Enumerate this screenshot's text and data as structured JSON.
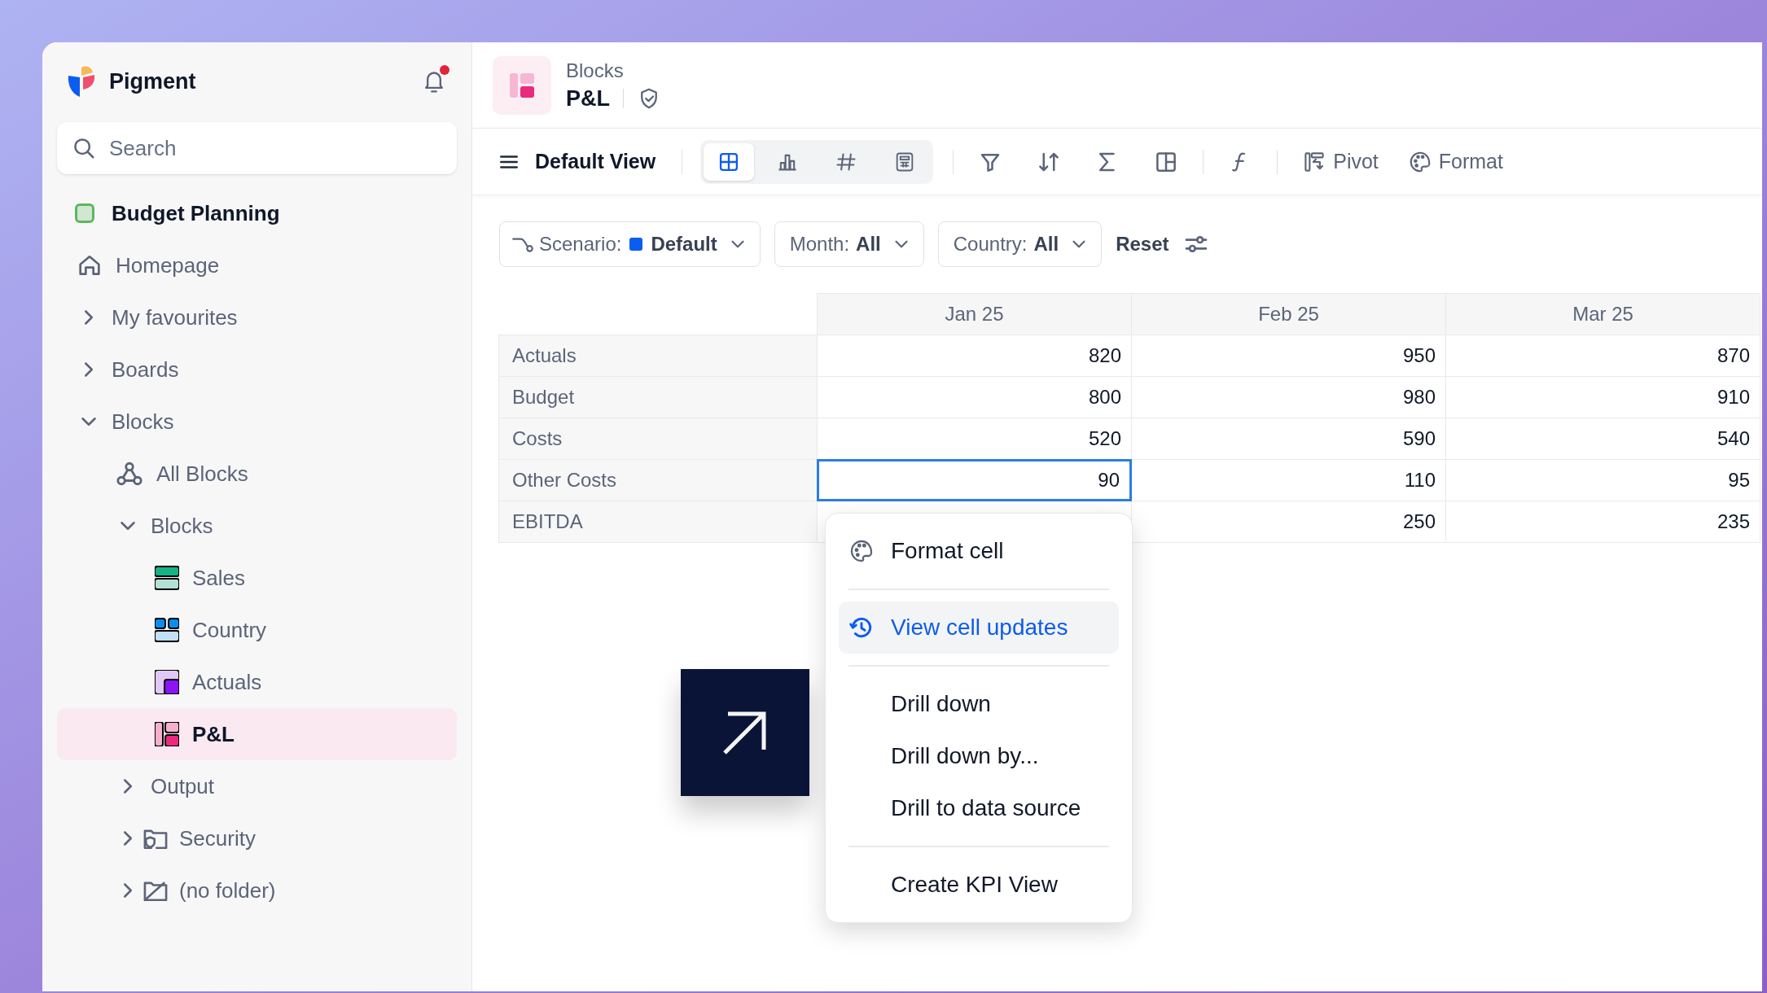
{
  "app": {
    "name": "Pigment",
    "notifications_unread": true
  },
  "sidebar": {
    "search": {
      "placeholder": "Search"
    },
    "workspace": {
      "label": "Budget Planning",
      "color": "#5cb85c"
    },
    "items": [
      {
        "label": "Homepage",
        "kind": "home",
        "selected": false
      },
      {
        "label": "My favourites",
        "kind": "folder",
        "expanded": false,
        "selected": false
      },
      {
        "label": "Boards",
        "kind": "folder",
        "expanded": false,
        "selected": false
      },
      {
        "label": "Blocks",
        "kind": "folder",
        "expanded": true,
        "selected": false,
        "children": [
          {
            "label": "All Blocks",
            "kind": "all-blocks",
            "selected": false
          },
          {
            "label": "Blocks",
            "kind": "folder",
            "expanded": true,
            "selected": false,
            "children": [
              {
                "label": "Sales",
                "kind": "list",
                "color": "#16b286",
                "selected": false
              },
              {
                "label": "Country",
                "kind": "dimension",
                "color": "#0a8cf0",
                "selected": false
              },
              {
                "label": "Actuals",
                "kind": "metric",
                "color": "#8a14f5",
                "selected": false
              },
              {
                "label": "P&L",
                "kind": "table",
                "color": "#ea2a7c",
                "selected": true
              }
            ]
          },
          {
            "label": "Output",
            "kind": "folder",
            "expanded": false,
            "selected": false
          },
          {
            "label": "Security",
            "kind": "security-folder",
            "expanded": false,
            "selected": false
          },
          {
            "label": "(no folder)",
            "kind": "no-folder",
            "expanded": false,
            "selected": false
          }
        ]
      }
    ]
  },
  "header": {
    "breadcrumb": "Blocks",
    "title": "P&L"
  },
  "toolbar": {
    "view_menu": "Default View",
    "view_modes": [
      {
        "kind": "grid",
        "selected": true
      },
      {
        "kind": "chart",
        "selected": false
      },
      {
        "kind": "kpi",
        "selected": false
      },
      {
        "kind": "sheet",
        "selected": false
      }
    ],
    "tool_groups": [
      [
        {
          "kind": "filter"
        },
        {
          "kind": "sort"
        },
        {
          "kind": "sum"
        },
        {
          "kind": "layout"
        }
      ],
      [
        {
          "kind": "function"
        }
      ]
    ],
    "buttons": [
      {
        "kind": "pivot",
        "label": "Pivot"
      },
      {
        "kind": "format",
        "label": "Format"
      }
    ]
  },
  "filters": [
    {
      "kind": "scenario",
      "label": "Scenario:",
      "value": "Default",
      "color": "#0b5cf0"
    },
    {
      "kind": "dropdown",
      "label": "Month:",
      "value": "All"
    },
    {
      "kind": "dropdown",
      "label": "Country:",
      "value": "All"
    }
  ],
  "reset": "Reset",
  "table": {
    "columns": [
      "Jan 25",
      "Feb 25",
      "Mar 25"
    ],
    "rows": [
      {
        "label": "Actuals",
        "cells": [
          {
            "value": "820",
            "selected": false
          },
          {
            "value": "950",
            "selected": false
          },
          {
            "value": "870",
            "selected": false
          }
        ]
      },
      {
        "label": "Budget",
        "cells": [
          {
            "value": "800",
            "selected": false
          },
          {
            "value": "980",
            "selected": false
          },
          {
            "value": "910",
            "selected": false
          }
        ]
      },
      {
        "label": "Costs",
        "cells": [
          {
            "value": "520",
            "selected": false
          },
          {
            "value": "590",
            "selected": false
          },
          {
            "value": "540",
            "selected": false
          }
        ]
      },
      {
        "label": "Other Costs",
        "cells": [
          {
            "value": "90",
            "selected": true
          },
          {
            "value": "110",
            "selected": false
          },
          {
            "value": "95",
            "selected": false
          }
        ]
      },
      {
        "label": "EBITDA",
        "cells": [
          {
            "selected": false
          },
          {
            "value": "250",
            "selected": false
          },
          {
            "value": "235",
            "selected": false
          }
        ]
      }
    ]
  },
  "context_menu": {
    "groups": [
      [
        {
          "label": "Format cell",
          "kind": "palette",
          "selected": false
        }
      ],
      [
        {
          "label": "View cell updates",
          "kind": "history",
          "selected": true
        }
      ],
      [
        {
          "label": "Drill down",
          "kind": "plain",
          "selected": false
        },
        {
          "label": "Drill down by...",
          "kind": "plain",
          "selected": false
        },
        {
          "label": "Drill to data source",
          "kind": "plain",
          "selected": false
        }
      ],
      [
        {
          "label": "Create KPI View",
          "kind": "plain",
          "selected": false
        }
      ]
    ]
  }
}
